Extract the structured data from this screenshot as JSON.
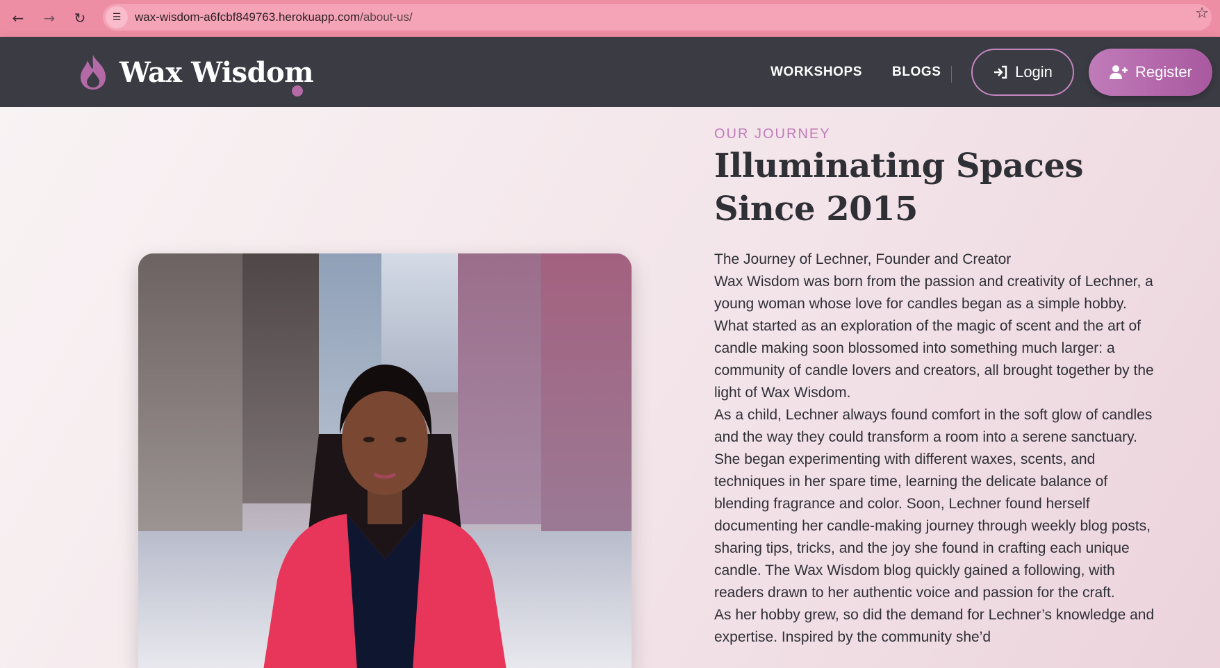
{
  "browser": {
    "url_domain": "wax-wisdom-a6fcbf849763.herokuapp.com",
    "url_path": "/about-us/"
  },
  "header": {
    "brand": "Wax Wisdom",
    "nav": [
      "WORKSHOPS",
      "BLOGS"
    ],
    "login_label": "Login",
    "register_label": "Register"
  },
  "about": {
    "eyebrow": "OUR JOURNEY",
    "headline": "Illuminating Spaces Since 2015",
    "subtitle": "The Journey of Lechner, Founder and Creator",
    "paragraphs": [
      "Wax Wisdom was born from the passion and creativity of Lechner, a young woman whose love for candles began as a simple hobby. What started as an exploration of the magic of scent and the art of candle making soon blossomed into something much larger: a community of candle lovers and creators, all brought together by the light of Wax Wisdom.",
      "As a child, Lechner always found comfort in the soft glow of candles and the way they could transform a room into a serene sanctuary. She began experimenting with different waxes, scents, and techniques in her spare time, learning the delicate balance of blending fragrance and color. Soon, Lechner found herself documenting her candle-making journey through weekly blog posts, sharing tips, tricks, and the joy she found in crafting each unique candle. The Wax Wisdom blog quickly gained a following, with readers drawn to her authentic voice and passion for the craft.",
      "As her hobby grew, so did the demand for Lechner’s knowledge and expertise. Inspired by the community she’d"
    ]
  },
  "colors": {
    "browser_bar": "#ee8ea5",
    "header_bg": "#3a3b43",
    "accent": "#c07bb9",
    "text": "#2f2f36"
  },
  "icons": [
    "back-arrow-icon",
    "forward-arrow-icon",
    "reload-icon",
    "site-info-icon",
    "bookmark-star-icon",
    "flame-logo-icon",
    "login-icon",
    "user-plus-icon"
  ]
}
